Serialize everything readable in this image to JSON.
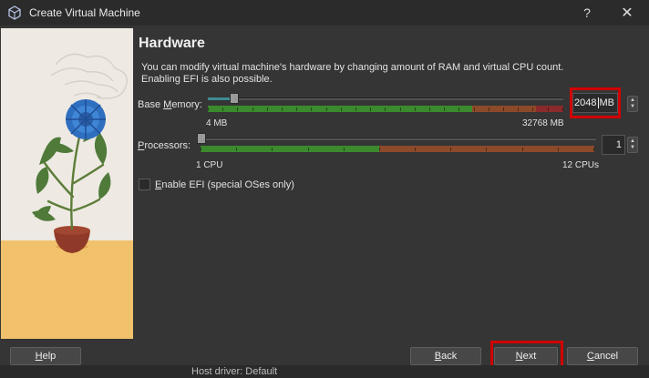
{
  "window": {
    "title": "Create Virtual Machine",
    "help_glyph": "?",
    "close_glyph": "✕"
  },
  "page": {
    "heading": "Hardware",
    "description": "You can modify virtual machine's hardware by changing amount of RAM and virtual CPU count. Enabling EFI is also possible."
  },
  "memory": {
    "label_pre": "Base ",
    "label_key": "M",
    "label_post": "emory:",
    "min_label": "4 MB",
    "max_label": "32768 MB",
    "value": "2048",
    "unit": "MB",
    "min": 4,
    "max": 32768,
    "current": 2048
  },
  "processors": {
    "label_key": "P",
    "label_post": "rocessors:",
    "min_label": "1 CPU",
    "max_label": "12 CPUs",
    "value": "1",
    "min": 1,
    "max": 12,
    "current": 1
  },
  "efi": {
    "label_key": "E",
    "label_post": "nable EFI (special OSes only)",
    "checked": false
  },
  "buttons": {
    "help_key": "H",
    "help_post": "elp",
    "back_key": "B",
    "back_post": "ack",
    "next_key": "N",
    "next_post": "ext",
    "cancel_key": "C",
    "cancel_post": "ancel"
  },
  "background_text": "Host driver: Default",
  "colors": {
    "highlight": "#d10000",
    "scale_green": "#3c8a2e",
    "scale_orange": "#8c4a2a",
    "scale_red": "#8a2a2a",
    "slider_teal": "#3c8b92"
  }
}
